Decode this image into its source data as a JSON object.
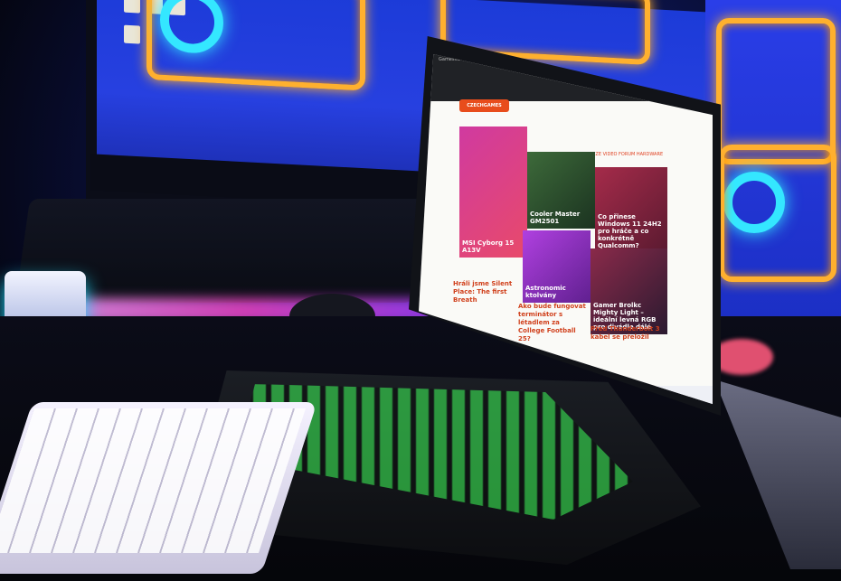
{
  "browser": {
    "tab_title": "Gamesite"
  },
  "website": {
    "logo_text": "CZECHGAMES",
    "nav": "AKTUALITY   RECENZE   VIDEO   FORUM   HARDWARE",
    "tiles": [
      {
        "label": "Cooler Master GM2501"
      },
      {
        "label": "Co přinese Windows 11 24H2 pro hráče a co konkrétně Qualcomm?"
      },
      {
        "label": "MSI Cyborg 15 A13V"
      },
      {
        "label": "Astronomic ktolvány"
      },
      {
        "label": "Gamer Brolkc Mighty Light – ideální levná RGB pro divádle dálé"
      }
    ],
    "articles": [
      "Hráli jsme Silent Place: The first Breath",
      "Ako bude fungovat terminátor s létadlem za College Football 25?",
      "Před Thunderbolt 3 kabel se přeložil"
    ]
  },
  "colors": {
    "accent": "#e04020",
    "keyboard_glow": "#3fff5a",
    "neon_orange": "#ffb02e",
    "neon_cyan": "#34e7ff",
    "monitor_blue": "#2740e0"
  }
}
